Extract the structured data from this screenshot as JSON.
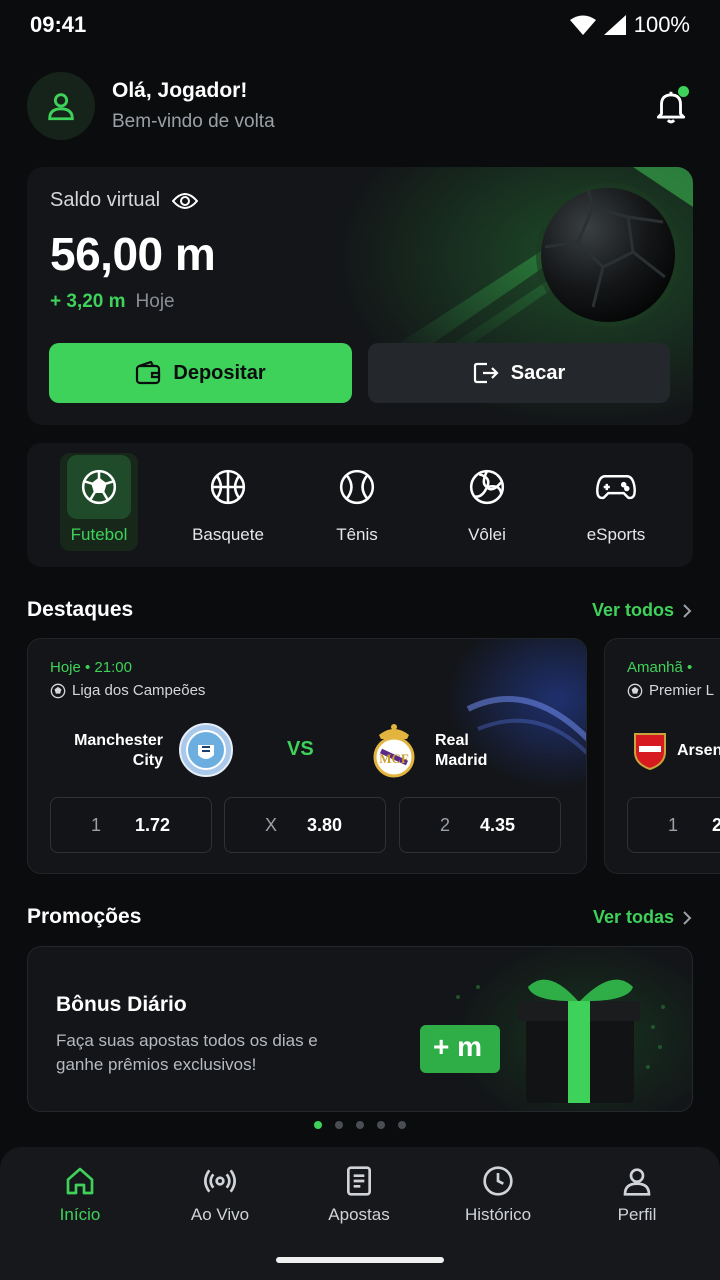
{
  "status": {
    "time": "09:41",
    "battery": "100%"
  },
  "header": {
    "greeting": "Olá, Jogador!",
    "welcome": "Bem-vindo de volta"
  },
  "balance": {
    "label": "Saldo virtual",
    "value": "56,00 m",
    "delta": "+ 3,20 m",
    "delta_period": "Hoje",
    "deposit_label": "Depositar",
    "withdraw_label": "Sacar"
  },
  "sports": [
    {
      "label": "Futebol",
      "icon": "soccer-ball-icon",
      "active": true
    },
    {
      "label": "Basquete",
      "icon": "basketball-icon"
    },
    {
      "label": "Tênis",
      "icon": "tennis-ball-icon"
    },
    {
      "label": "Vôlei",
      "icon": "volleyball-icon"
    },
    {
      "label": "eSports",
      "icon": "gamepad-icon"
    }
  ],
  "highlights": {
    "title": "Destaques",
    "see_all": "Ver todos",
    "matches": [
      {
        "time": "Hoje • 21:00",
        "league": "Liga dos Campeões",
        "home": "Manchester City",
        "home_line1": "Manchester",
        "home_line2": "City",
        "away": "Real Madrid",
        "away_line1": "Real",
        "away_line2": "Madrid",
        "vs": "VS",
        "odds": [
          {
            "key": "1",
            "value": "1.72"
          },
          {
            "key": "X",
            "value": "3.80"
          },
          {
            "key": "2",
            "value": "4.35"
          }
        ]
      },
      {
        "time": "Amanhã •",
        "league": "Premier L",
        "home": "Arsena",
        "odds": [
          {
            "key": "1",
            "value": "2"
          }
        ]
      }
    ]
  },
  "promotions": {
    "title": "Promoções",
    "see_all": "Ver todas",
    "card_title": "Bônus Diário",
    "card_desc": "Faça suas apostas todos os dias e ganhe prêmios exclusivos!",
    "badge": "+ m",
    "dots_total": 5,
    "dots_active": 0
  },
  "nav": [
    {
      "label": "Início",
      "icon": "home-icon",
      "active": true
    },
    {
      "label": "Ao Vivo",
      "icon": "live-broadcast-icon"
    },
    {
      "label": "Apostas",
      "icon": "bets-list-icon"
    },
    {
      "label": "Histórico",
      "icon": "clock-icon"
    },
    {
      "label": "Perfil",
      "icon": "user-icon"
    }
  ],
  "colors": {
    "accent": "#3fd25a",
    "background": "#0b0c0e",
    "card": "#131518"
  }
}
